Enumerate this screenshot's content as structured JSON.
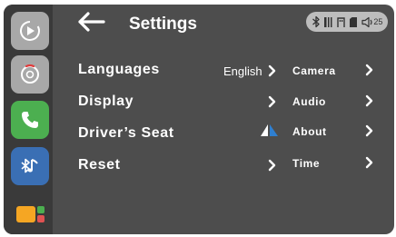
{
  "header": {
    "title": "Settings"
  },
  "status": {
    "volume": "25"
  },
  "menu_left": [
    {
      "label": "Languages",
      "value": "English"
    },
    {
      "label": "Display"
    },
    {
      "label": "Driver’s Seat"
    },
    {
      "label": "Reset"
    }
  ],
  "menu_right": [
    {
      "label": "Camera"
    },
    {
      "label": "Audio"
    },
    {
      "label": "About"
    },
    {
      "label": "Time"
    }
  ],
  "dock": {
    "icons": [
      "carplay-icon",
      "siri-icon",
      "phone-icon",
      "bluetooth-music-icon",
      "apps-icon"
    ]
  },
  "colors": {
    "background": "#4d4d4d",
    "phone_green": "#4caf50",
    "bluetooth_blue": "#3a6fb4",
    "seat_blue": "#2f7fd0"
  }
}
